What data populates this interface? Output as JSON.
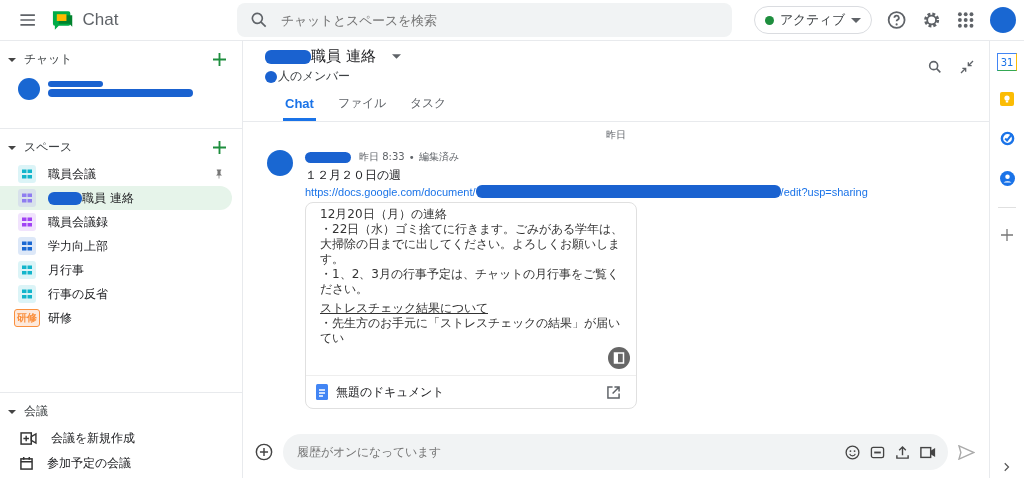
{
  "app": {
    "name": "Chat"
  },
  "search": {
    "placeholder": "チャットとスペースを検索"
  },
  "status": {
    "label": "アクティブ",
    "color": "#1e8e3e"
  },
  "chats_section": {
    "title": "チャット",
    "expanded": true
  },
  "spaces_section": {
    "title": "スペース",
    "expanded": true,
    "items": [
      {
        "name": "職員会議",
        "color": "#12b5cb",
        "kind": "space",
        "pinned": true,
        "selected": false,
        "redacted": false
      },
      {
        "name": "職員 連絡",
        "color": "#8e7cf0",
        "kind": "space",
        "pinned": false,
        "selected": true,
        "redacted": true
      },
      {
        "name": "職員会議録",
        "color": "#a142f4",
        "kind": "space",
        "pinned": false,
        "selected": false,
        "redacted": false
      },
      {
        "name": "学力向上部",
        "color": "#1967d2",
        "kind": "space",
        "pinned": false,
        "selected": false,
        "redacted": false
      },
      {
        "name": "月行事",
        "color": "#12b5cb",
        "kind": "space",
        "pinned": false,
        "selected": false,
        "redacted": false
      },
      {
        "name": "行事の反省",
        "color": "#12b5cb",
        "kind": "space",
        "pinned": false,
        "selected": false,
        "redacted": false
      },
      {
        "name": "研修",
        "color": "#fa903e",
        "kind": "text",
        "icon_text": "研修",
        "pinned": false,
        "selected": false,
        "redacted": false
      }
    ]
  },
  "meetings_section": {
    "title": "会議",
    "expanded": true,
    "items": [
      {
        "label": "会議を新規作成",
        "kind": "new"
      },
      {
        "label": "参加予定の会議",
        "kind": "calendar"
      }
    ]
  },
  "conversation": {
    "title": "職員 連絡",
    "members": "人のメンバー",
    "tabs": [
      {
        "label": "Chat",
        "selected": true
      },
      {
        "label": "ファイル",
        "selected": false
      },
      {
        "label": "タスク",
        "selected": false
      }
    ]
  },
  "date_divider": "昨日",
  "message": {
    "time": "昨日 8:33",
    "separator": "•",
    "edited": "編集済み",
    "text": "１２月２０日の週",
    "link_start": "https://docs.google.com/document/",
    "link_end": "/edit?usp=sharing",
    "attachment": {
      "lines": [
        "12月20日（月）の連絡",
        "・22日（水）ゴミ捨てに行きます。ごみがある学年は、大掃除の日までに出してください。よろしくお願いします。",
        "・1、2、3月の行事予定は、チャットの月行事をご覧ください。"
      ],
      "heading": "ストレスチェック結果について",
      "after": "・先生方のお手元に「ストレスチェックの結果」が届いてい",
      "name": "無題のドキュメント"
    }
  },
  "composer": {
    "placeholder": "履歴がオンになっています"
  },
  "rail": {
    "calendar_day": "31"
  }
}
